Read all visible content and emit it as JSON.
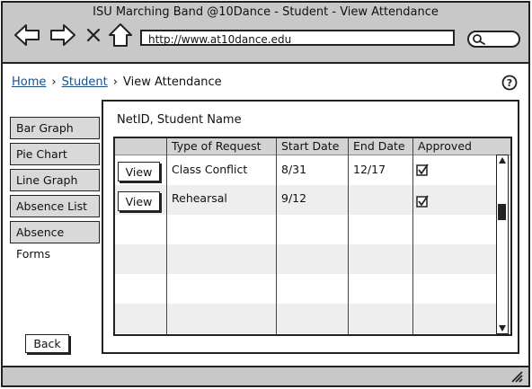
{
  "window": {
    "title": "ISU Marching Band @10Dance - Student - View Attendance"
  },
  "browser": {
    "url": "http://www.at10dance.edu"
  },
  "breadcrumb": {
    "home": "Home",
    "student": "Student",
    "current": "View Attendance"
  },
  "sidebar": {
    "tabs": [
      {
        "label": "Bar Graph"
      },
      {
        "label": "Pie Chart"
      },
      {
        "label": "Line Graph"
      },
      {
        "label": "Absence List"
      },
      {
        "label": "Absence Forms"
      }
    ]
  },
  "main": {
    "heading": "NetID, Student Name",
    "table": {
      "columns": [
        "",
        "Type of Request",
        "Start Date",
        "End Date",
        "Approved"
      ],
      "rows": [
        {
          "action": "View",
          "type": "Class Conflict",
          "start": "8/31",
          "end": "12/17",
          "approved": true
        },
        {
          "action": "View",
          "type": "Rehearsal",
          "start": "9/12",
          "end": "",
          "approved": true
        }
      ]
    },
    "back_label": "Back"
  }
}
